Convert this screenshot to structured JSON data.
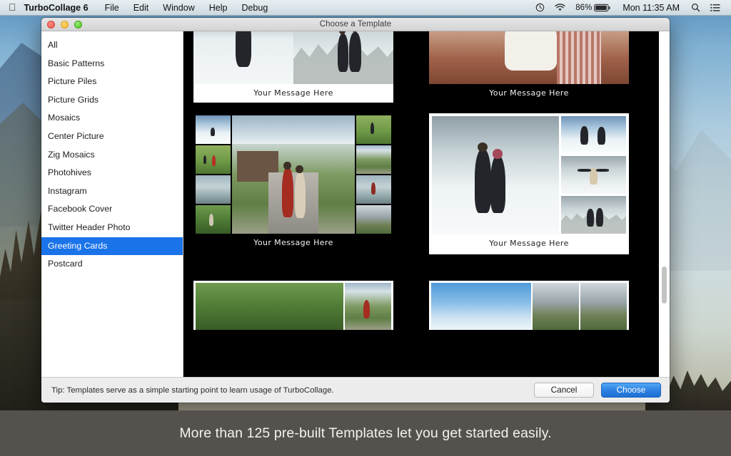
{
  "menubar": {
    "apple_icon": "apple-logo-icon",
    "app_name": "TurboCollage 6",
    "items": [
      "File",
      "Edit",
      "Window",
      "Help",
      "Debug"
    ],
    "status": {
      "timemachine_icon": "time-machine-icon",
      "wifi_icon": "wifi-icon",
      "battery_percent": "86%",
      "battery_icon": "battery-icon",
      "clock": "Mon 11:35 AM",
      "search_icon": "search-icon",
      "notification_icon": "notification-list-icon"
    }
  },
  "dialog": {
    "title": "Choose a Template",
    "window_controls": {
      "close": "close-button",
      "minimize": "minimize-button",
      "zoom": "zoom-button"
    },
    "sidebar": {
      "items": [
        {
          "label": "All",
          "selected": false
        },
        {
          "label": "Basic Patterns",
          "selected": false
        },
        {
          "label": "Picture Piles",
          "selected": false
        },
        {
          "label": "Picture Grids",
          "selected": false
        },
        {
          "label": "Mosaics",
          "selected": false
        },
        {
          "label": "Center Picture",
          "selected": false
        },
        {
          "label": "Zig Mosaics",
          "selected": false
        },
        {
          "label": "Photohives",
          "selected": false
        },
        {
          "label": "Instagram",
          "selected": false
        },
        {
          "label": "Facebook Cover",
          "selected": false
        },
        {
          "label": "Twitter Header Photo",
          "selected": false
        },
        {
          "label": "Greeting Cards",
          "selected": true
        },
        {
          "label": "Postcard",
          "selected": false
        }
      ],
      "selected_label": "Greeting Cards",
      "selection_color": "#1a73e8"
    },
    "gallery": {
      "background_color": "#000000",
      "templates": [
        {
          "id": "tpl-1",
          "caption": "Your Message Here",
          "style": "light"
        },
        {
          "id": "tpl-2",
          "caption": "Your Message Here",
          "style": "dark"
        },
        {
          "id": "tpl-3",
          "caption": "Your Message Here",
          "style": "dark"
        },
        {
          "id": "tpl-4",
          "caption": "Your Message Here",
          "style": "light"
        },
        {
          "id": "tpl-5",
          "caption": "",
          "style": "light"
        },
        {
          "id": "tpl-6",
          "caption": "",
          "style": "light"
        }
      ]
    },
    "footer": {
      "tip": "Tip: Templates serve as a simple starting point to learn usage of TurboCollage.",
      "cancel_label": "Cancel",
      "choose_label": "Choose",
      "choose_color": "#2a7fe0"
    }
  },
  "caption": {
    "text": "More than 125 pre-built Templates let you get started easily.",
    "background_color": "#55524e"
  }
}
